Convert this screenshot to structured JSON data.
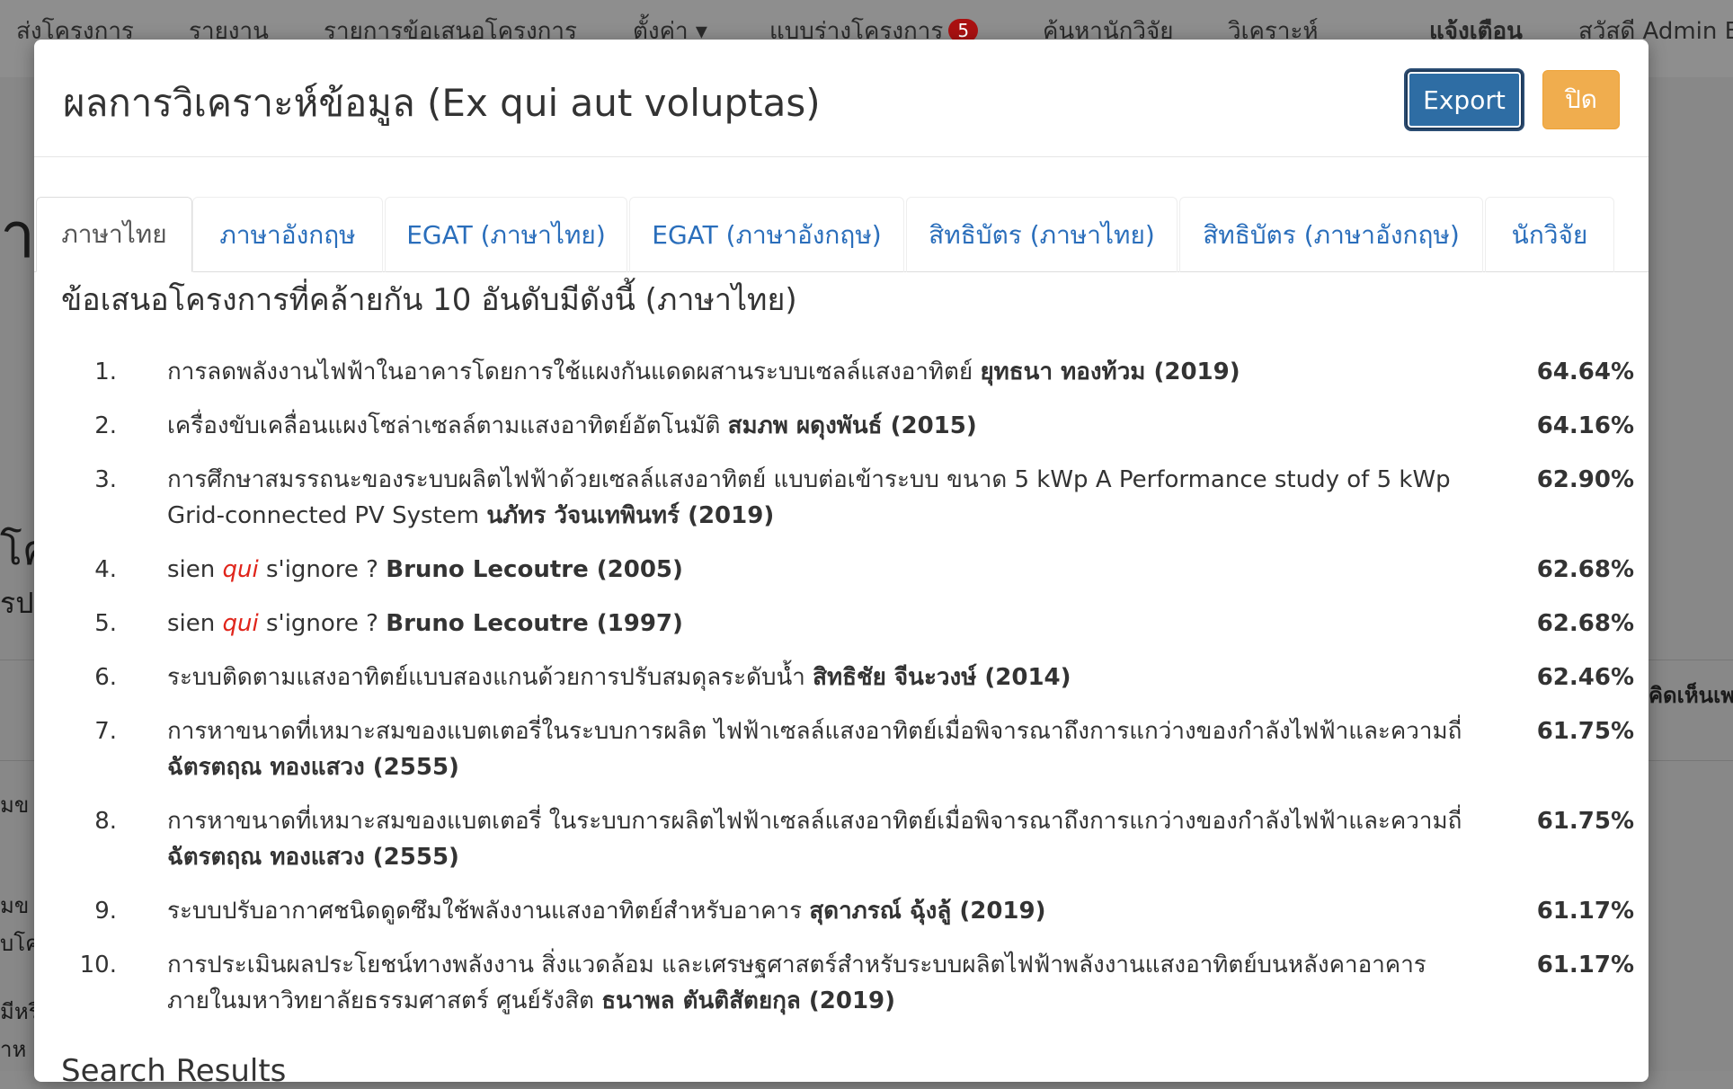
{
  "nav": {
    "items": [
      "ส่งโครงการ",
      "รายงาน",
      "รายการข้อเสนอโครงการ",
      "ตั้งค่า ▾",
      "แบบร่างโครงการ",
      "ค้นหานักวิจัย",
      "วิเคราะห์",
      "แจ้งเตือน",
      "สวัสดี Admin E"
    ],
    "badge": "5"
  },
  "background": {
    "frag_a": "า",
    "frag_b": "โค",
    "frag_c": "รป",
    "frag_d": "มข",
    "frag_e": "มข",
    "frag_f": "บโค",
    "frag_g": "มีหรื",
    "frag_h": "ำห",
    "frag_right": "คิดเห็นเพ"
  },
  "modal": {
    "title": "ผลการวิเคราะห์ข้อมูล (Ex qui aut voluptas)",
    "export_label": "Export",
    "close_label": "ปิด",
    "tabs": [
      "ภาษาไทย",
      "ภาษาอังกฤษ",
      "EGAT (ภาษาไทย)",
      "EGAT (ภาษาอังกฤษ)",
      "สิทธิบัตร (ภาษาไทย)",
      "สิทธิบัตร (ภาษาอังกฤษ)",
      "นักวิจัย"
    ],
    "active_tab": "ภาษาไทย",
    "heading": "ข้อเสนอโครงการที่คล้ายกัน 10 อันดับมีดังนี้ (ภาษาไทย)",
    "results": [
      {
        "num": "1.",
        "title_line1": "การลดพลังงานไฟฟ้าในอาคารโดยการใช้แผงกันแดดผสานระบบเซลล์แสงอาทิตย์",
        "author_line1": "ยุทธนา ทองท้วม (2019)",
        "title_line2": "",
        "author_line2": "",
        "pct": "64.64%"
      },
      {
        "num": "2.",
        "title_line1": "เครื่องขับเคลื่อนแผงโซล่าเซลล์ตามแสงอาทิตย์อัตโนมัติ",
        "author_line1": "สมภพ ผดุงพันธ์ (2015)",
        "title_line2": "",
        "author_line2": "",
        "pct": "64.16%"
      },
      {
        "num": "3.",
        "title_line1": "การศึกษาสมรรถนะของระบบผลิตไฟฟ้าด้วยเซลล์แสงอาทิตย์ แบบต่อเข้าระบบ ขนาด 5 kWp A Performance study of 5 kWp",
        "author_line1": "",
        "title_line2": "Grid-connected PV System",
        "author_line2": "นภัทร วัจนเทพินทร์ (2019)",
        "pct": "62.90%"
      },
      {
        "num": "4.",
        "pre": "sien",
        "red": "qui",
        "post": "s'ignore ?",
        "author_line1": "Bruno Lecoutre (2005)",
        "pct": "62.68%"
      },
      {
        "num": "5.",
        "pre": "sien",
        "red": "qui",
        "post": "s'ignore ?",
        "author_line1": "Bruno Lecoutre (1997)",
        "pct": "62.68%"
      },
      {
        "num": "6.",
        "title_line1": "ระบบติดตามแสงอาทิตย์แบบสองแกนด้วยการปรับสมดุลระดับน้ำ",
        "author_line1": "สิทธิชัย จีนะวงษ์ (2014)",
        "title_line2": "",
        "author_line2": "",
        "pct": "62.46%"
      },
      {
        "num": "7.",
        "title_line1": "การหาขนาดที่เหมาะสมของแบตเตอรี่ในระบบการผลิต ไฟฟ้าเซลล์แสงอาทิตย์เมื่อพิจารณาถึงการแกว่างของกำลังไฟฟ้าและความถี่",
        "author_line1": "",
        "title_line2": "",
        "author_line2": "ฉัตรตฤณ ทองแสวง (2555)",
        "pct": "61.75%"
      },
      {
        "num": "8.",
        "title_line1": "การหาขนาดที่เหมาะสมของแบตเตอรี่ ในระบบการผลิตไฟฟ้าเซลล์แสงอาทิตย์เมื่อพิจารณาถึงการแกว่างของกำลังไฟฟ้าและความถี่",
        "author_line1": "",
        "title_line2": "",
        "author_line2": "ฉัตรตฤณ ทองแสวง (2555)",
        "pct": "61.75%"
      },
      {
        "num": "9.",
        "title_line1": "ระบบปรับอากาศชนิดดูดซึมใช้พลังงานแสงอาทิตย์สำหรับอาคาร",
        "author_line1": "สุดาภรณ์ ฉุ้งลู้ (2019)",
        "title_line2": "",
        "author_line2": "",
        "pct": "61.17%"
      },
      {
        "num": "10.",
        "title_line1": "การประเมินผลประโยชน์ทางพลังงาน สิ่งแวดล้อม และเศรษฐศาสตร์สำหรับระบบผลิตไฟฟ้าพลังงานแสงอาทิตย์บนหลังคาอาคาร",
        "author_line1": "",
        "title_line2": "ภายในมหาวิทยาลัยธรรมศาสตร์ ศูนย์รังสิต",
        "author_line2": "ธนาพล ตันติสัตยกุล (2019)",
        "pct": "61.17%"
      }
    ],
    "next_heading_fragment": "Search Results"
  }
}
